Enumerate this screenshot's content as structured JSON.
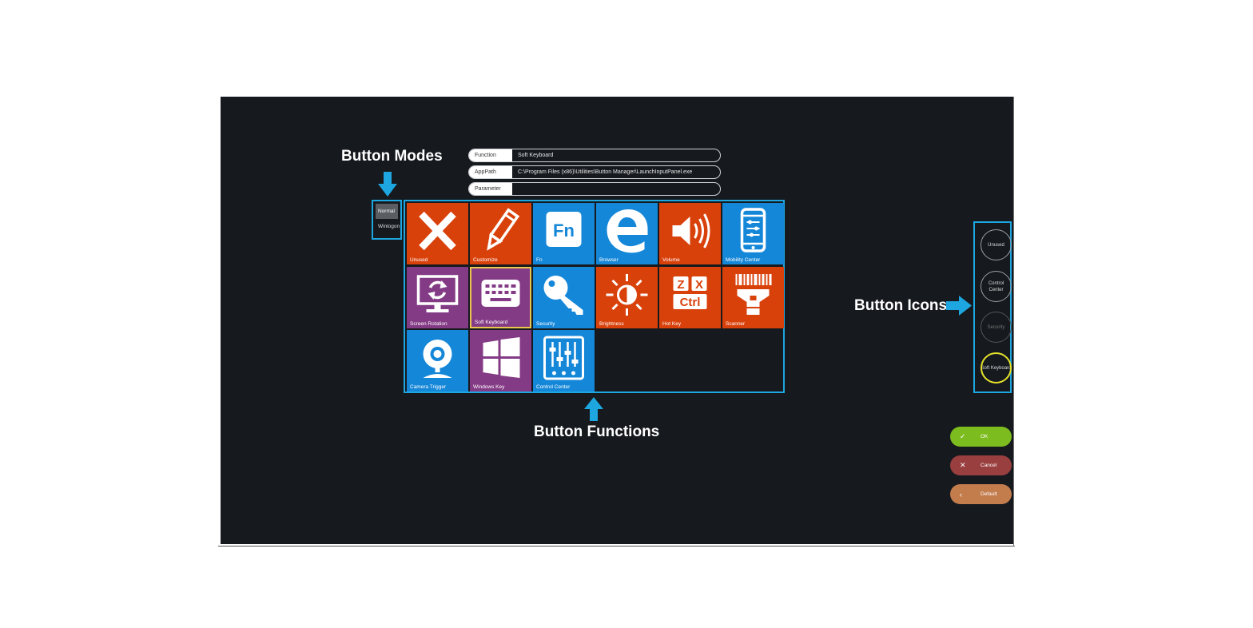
{
  "annotations": {
    "modes": "Button Modes",
    "functions": "Button Functions",
    "icons": "Button Icons"
  },
  "fields": [
    {
      "label": "Function",
      "value": "Soft Keyboard"
    },
    {
      "label": "AppPath",
      "value": "C:\\Program Files (x86)\\Utilities\\Button Manager\\LaunchInputPanel.exe"
    },
    {
      "label": "Parameter",
      "value": ""
    }
  ],
  "modes": [
    {
      "label": "Normal",
      "active": true
    },
    {
      "label": "Winlogon",
      "active": false
    }
  ],
  "tiles": [
    {
      "label": "Unused",
      "color": "#d9410b",
      "icon": "close-icon"
    },
    {
      "label": "Customize",
      "color": "#d9410b",
      "icon": "pencil-icon"
    },
    {
      "label": "Fn",
      "color": "#1587d8",
      "icon": "fn-key-icon"
    },
    {
      "label": "Browser",
      "color": "#1587d8",
      "icon": "edge-browser-icon"
    },
    {
      "label": "Volume",
      "color": "#d9410b",
      "icon": "speaker-icon"
    },
    {
      "label": "Mobility Center",
      "color": "#1587d8",
      "icon": "mobile-settings-icon"
    },
    {
      "label": "Screen Rotation",
      "color": "#843b86",
      "icon": "screen-rotation-icon"
    },
    {
      "label": "Soft Keyboard",
      "color": "#843b86",
      "icon": "keyboard-icon",
      "selected": true
    },
    {
      "label": "Security",
      "color": "#1587d8",
      "icon": "key-icon"
    },
    {
      "label": "Brightness",
      "color": "#d9410b",
      "icon": "brightness-icon"
    },
    {
      "label": "Hot Key",
      "color": "#d9410b",
      "icon": "hot-key-icon"
    },
    {
      "label": "Scanner",
      "color": "#d9410b",
      "icon": "barcode-scanner-icon"
    },
    {
      "label": "Camera Trigger",
      "color": "#1587d8",
      "icon": "webcam-icon"
    },
    {
      "label": "Windows Key",
      "color": "#843b86",
      "icon": "windows-logo-icon"
    },
    {
      "label": "Control Center",
      "color": "#1587d8",
      "icon": "sliders-icon"
    }
  ],
  "hotkey_letters": {
    "z": "Z",
    "x": "X",
    "ctrl": "Ctrl"
  },
  "fn_text": "Fn",
  "button_icons": [
    {
      "label": "Unused"
    },
    {
      "label": "Control Center"
    },
    {
      "label": "Security"
    },
    {
      "label": "Soft Keyboard"
    }
  ],
  "actions": {
    "ok": "OK",
    "cancel": "Cancel",
    "default": "Default"
  },
  "colors": {
    "accent": "#1da6e0",
    "background": "#16191e",
    "ok": "#7cbc1e",
    "cancel": "#9a3f3f",
    "default": "#c37c4c",
    "selected": "#e5e22a"
  }
}
